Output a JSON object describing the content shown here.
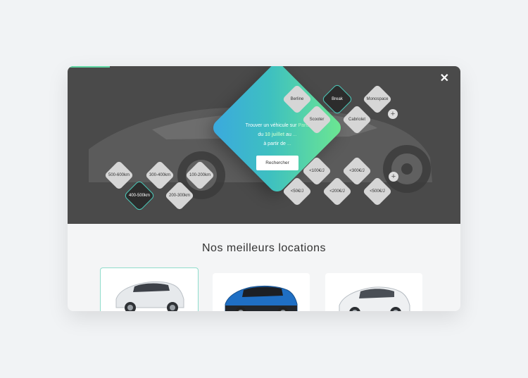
{
  "hero": {
    "close_label": "✕",
    "headline_prefix": "Trouver un véhicule sur ",
    "city": "Paris",
    "line2_prefix": "du ",
    "date_from": "10 juillet",
    "line2_mid": " au ",
    "date_to": "...",
    "line3_prefix": "à partir de ",
    "price_placeholder": "...",
    "search_label": "Rechercher"
  },
  "categories": [
    "Berline",
    "Break",
    "Monospace",
    "Scooter",
    "Cabriolet"
  ],
  "categories_selected": "Break",
  "distances": [
    "500-600km",
    "300-400km",
    "100-200km",
    "400-500km",
    "200-300km"
  ],
  "distances_selected": "400-500km",
  "prices": [
    "<100€/J",
    "<300€/J",
    "<50€/J",
    "<200€/J",
    "<500€/J"
  ],
  "more_label": "+",
  "section": {
    "title": "Nos meilleurs locations"
  },
  "locations": [
    {
      "name": "white-hatchback",
      "selected": true,
      "color": "#e9ecef"
    },
    {
      "name": "blue-compact-ev",
      "selected": false,
      "color": "#1f6fc4"
    },
    {
      "name": "white-ev-hatchback",
      "selected": false,
      "color": "#eef0f2"
    }
  ],
  "colors": {
    "accent_gradient_start": "#6ee88f",
    "accent_gradient_end": "#3aa8e0",
    "hero_bg": "#4a4a4a"
  }
}
